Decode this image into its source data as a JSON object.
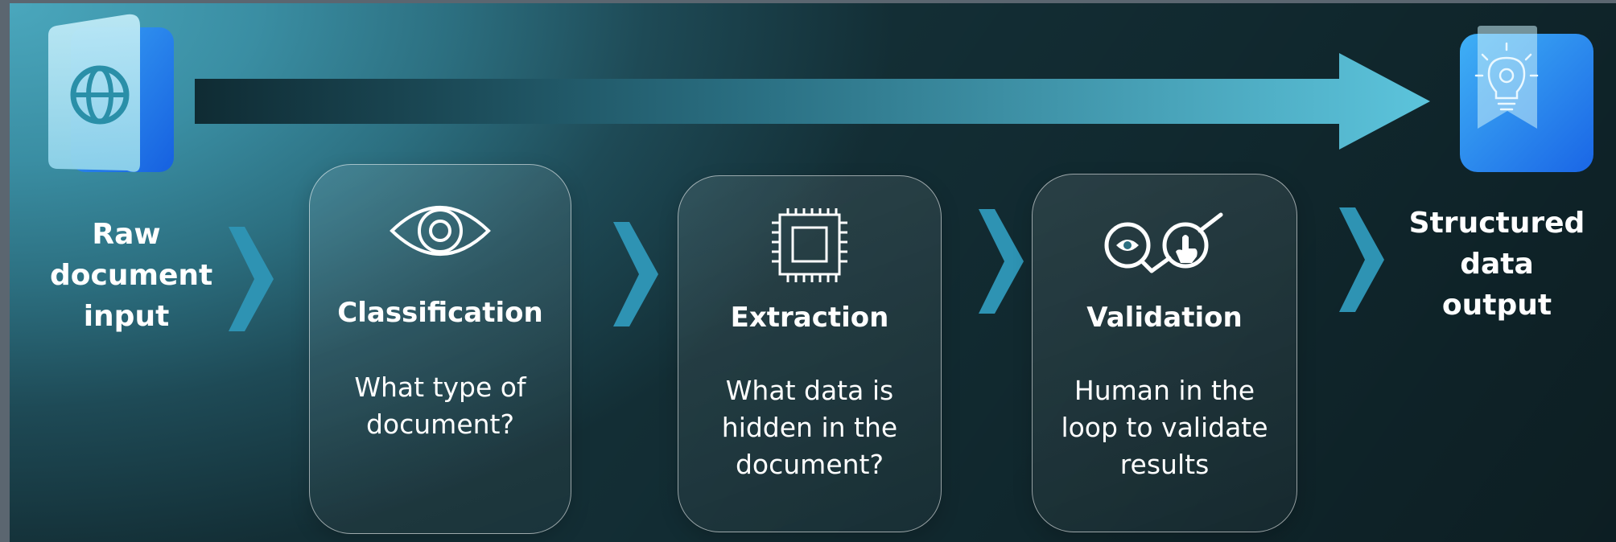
{
  "input": {
    "label": "Raw\ndocument\ninput",
    "icon": "globe-document-icon"
  },
  "output": {
    "label": "Structured\ndata\noutput",
    "icon": "lightbulb-bookmark-icon"
  },
  "steps": [
    {
      "title": "Classification",
      "description": "What type of\ndocument?",
      "icon": "eye-icon"
    },
    {
      "title": "Extraction",
      "description": "What data is\nhidden in the\ndocument?",
      "icon": "chip-icon"
    },
    {
      "title": "Validation",
      "description": "Human in the\nloop to validate\nresults",
      "icon": "magnifier-touch-icon"
    }
  ],
  "colors": {
    "chevron": "#2e93b3",
    "tile_light": "#a9dff0",
    "tile_blue": "#1f7fe8",
    "arrow_dark": "#0f2b33",
    "arrow_light": "#57c0d8"
  }
}
